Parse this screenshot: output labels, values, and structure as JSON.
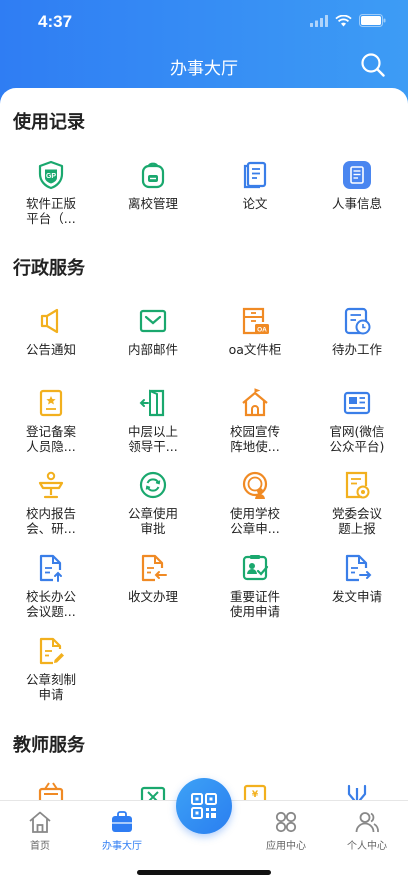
{
  "status_bar": {
    "time": "4:37"
  },
  "header": {
    "title": "办事大厅"
  },
  "sections": {
    "usage": {
      "title": "使用记录",
      "items": [
        {
          "label": "软件正版平台（...",
          "icon": "gp-shield-icon"
        },
        {
          "label": "离校管理",
          "icon": "backpack-icon"
        },
        {
          "label": "论文",
          "icon": "document-icon"
        },
        {
          "label": "人事信息",
          "icon": "personnel-list-icon"
        }
      ]
    },
    "admin": {
      "title": "行政服务",
      "items": [
        {
          "label": "公告通知",
          "icon": "megaphone-icon"
        },
        {
          "label": "内部邮件",
          "icon": "mail-icon"
        },
        {
          "label": "oa文件柜",
          "icon": "oa-cabinet-icon"
        },
        {
          "label": "待办工作",
          "icon": "todo-clock-icon"
        },
        {
          "label": "登记备案人员隐...",
          "icon": "registration-icon"
        },
        {
          "label": "中层以上领导干...",
          "icon": "door-exit-icon"
        },
        {
          "label": "校园宣传阵地使...",
          "icon": "campus-house-icon"
        },
        {
          "label": "官网(微信公众平台)",
          "icon": "news-icon"
        },
        {
          "label": "校内报告会、研...",
          "icon": "lectern-icon"
        },
        {
          "label": "公章使用审批",
          "icon": "seal-refresh-icon"
        },
        {
          "label": "使用学校公章申...",
          "icon": "seal-person-icon"
        },
        {
          "label": "党委会议题上报",
          "icon": "party-document-icon"
        },
        {
          "label": "校长办公会议题...",
          "icon": "document-upload-icon"
        },
        {
          "label": "收文办理",
          "icon": "document-receive-icon"
        },
        {
          "label": "重要证件使用申请",
          "icon": "certificate-icon"
        },
        {
          "label": "发文申请",
          "icon": "document-send-icon"
        },
        {
          "label": "公章刻制申请",
          "icon": "document-edit-icon"
        }
      ]
    },
    "teacher": {
      "title": "教师服务"
    }
  },
  "tabbar": {
    "home": "首页",
    "hall": "办事大厅",
    "apps": "应用中心",
    "profile": "个人中心"
  },
  "colors": {
    "header_start": "#2f7df3",
    "header_end": "#3d9cf5",
    "green": "#1aa86e",
    "blue": "#3a7ee8",
    "orange": "#f08a24",
    "yellow": "#f2b01e",
    "active_tab": "#2f7df3"
  }
}
